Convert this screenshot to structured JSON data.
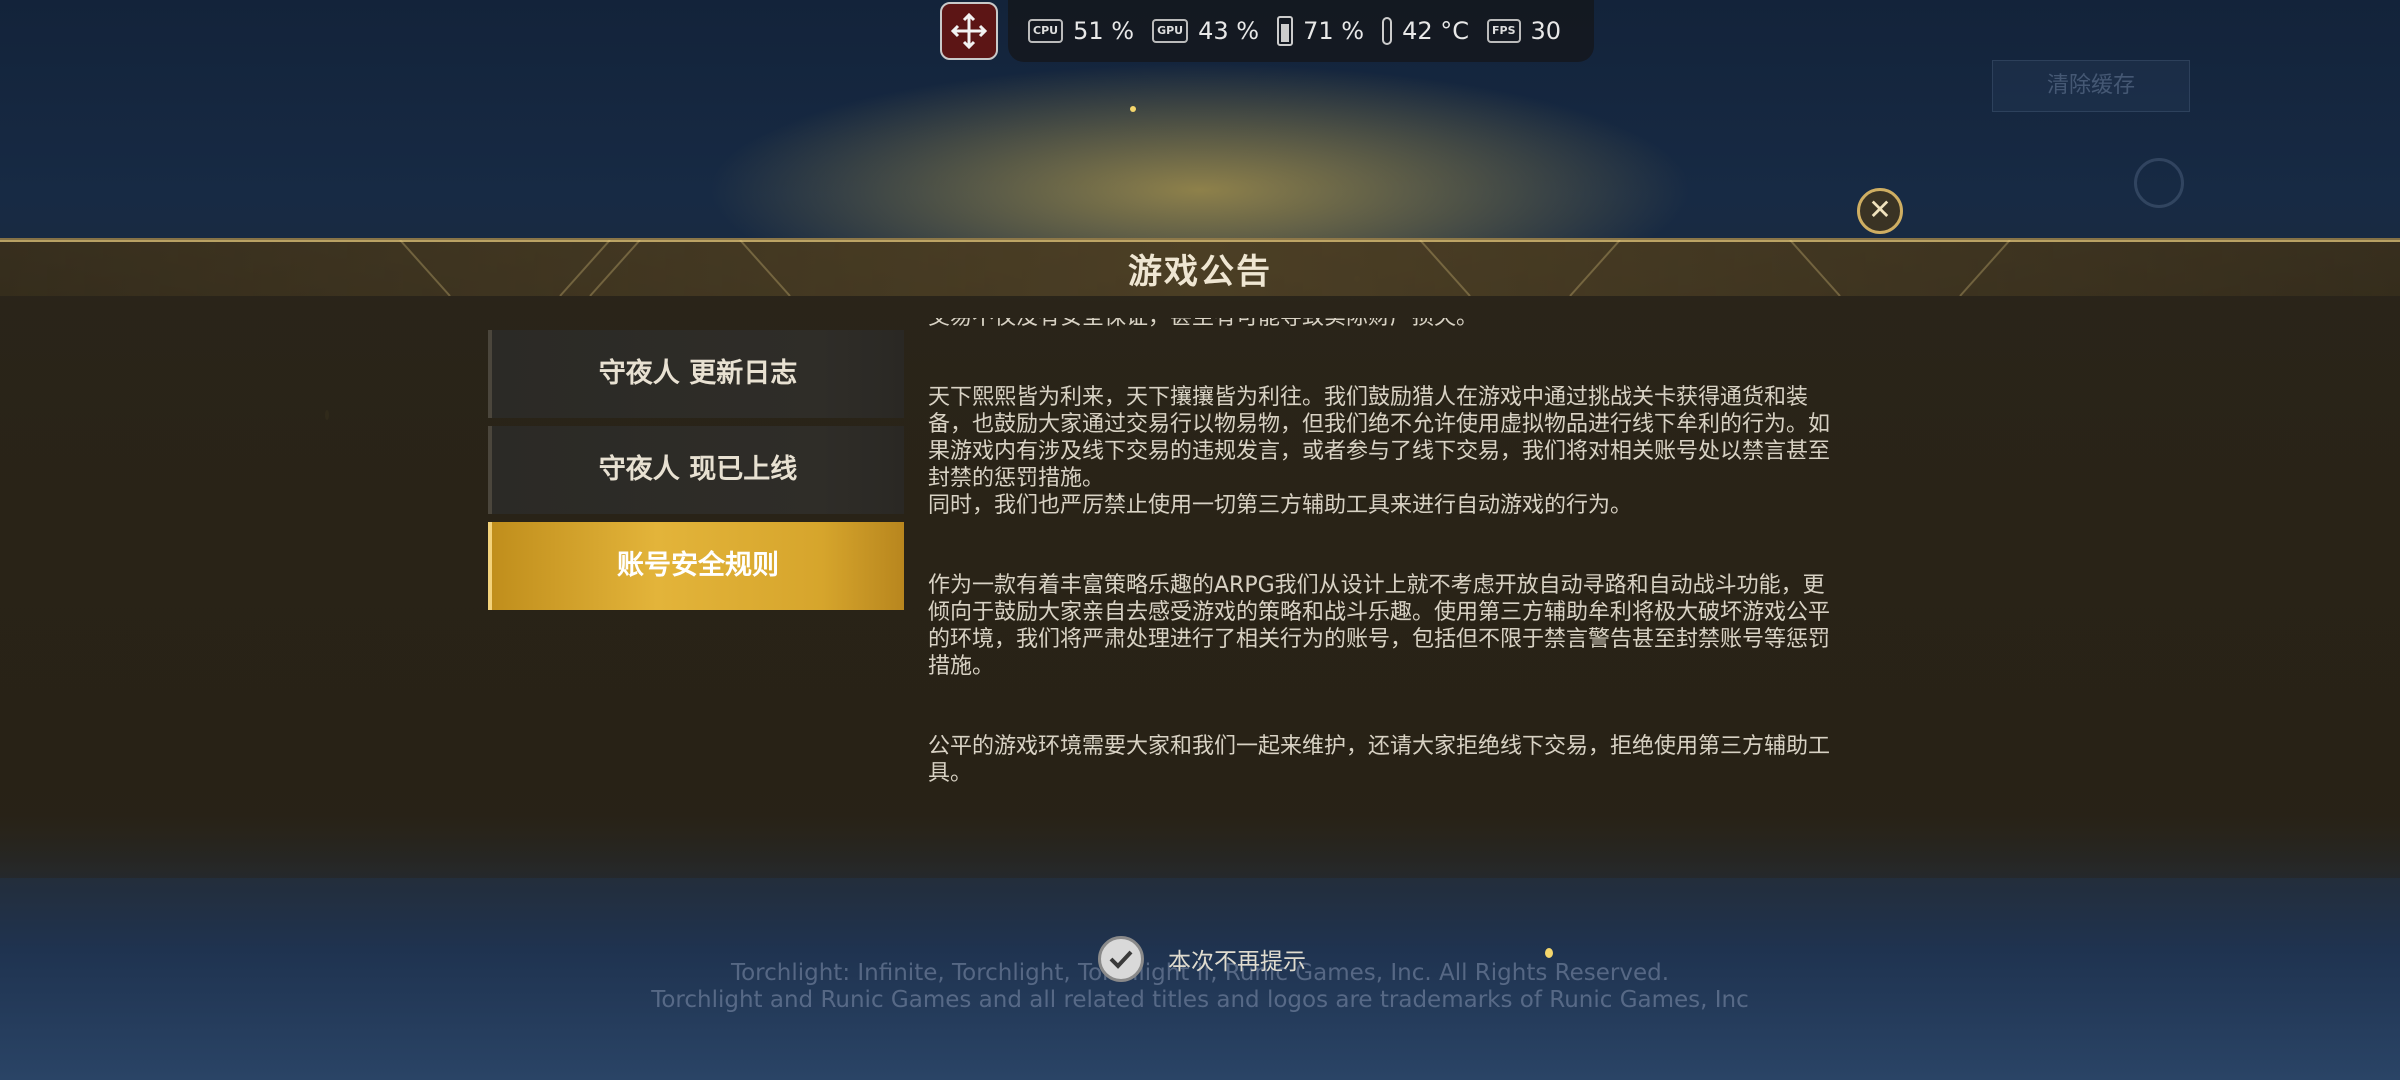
{
  "background": {
    "top_notice": "",
    "clear_cache_label": "清除缓存",
    "legal_lines": [
      "Torchlight: Infinite, Torchlight, Torchlight II, Runic Games, Inc. All Rights Reserved.",
      "Torchlight and Runic Games and all related titles and logos are trademarks of Runic Games, Inc"
    ]
  },
  "hud": {
    "cpu": "51 %",
    "gpu": "43 %",
    "battery": "71 %",
    "temperature": "42 °C",
    "fps": "30",
    "cpu_chip": "CPU",
    "gpu_chip": "GPU",
    "fps_chip": "FPS"
  },
  "dialog": {
    "title": "游戏公告",
    "close_symbol": "✕",
    "menu": [
      {
        "label": "守夜人 更新日志",
        "active": false
      },
      {
        "label": "守夜人 现已上线",
        "active": false
      },
      {
        "label": "账号安全规则",
        "active": true
      }
    ],
    "paragraphs": [
      "交易不仅没有安全保证，甚至有可能导致实际财产损失。",
      "天下熙熙皆为利来，天下攘攘皆为利往。我们鼓励猎人在游戏中通过挑战关卡获得通货和装备，也鼓励大家通过交易行以物易物，但我们绝不允许使用虚拟物品进行线下牟利的行为。如果游戏内有涉及线下交易的违规发言，或者参与了线下交易，我们将对相关账号处以禁言甚至封禁的惩罚措施。",
      "同时，我们也严厉禁止使用一切第三方辅助工具来进行自动游戏的行为。",
      "作为一款有着丰富策略乐趣的ARPG我们从设计上就不考虑开放自动寻路和自动战斗功能，更倾向于鼓励大家亲自去感受游戏的策略和战斗乐趣。使用第三方辅助牟利将极大破坏游戏公平的环境，我们将严肃处理进行了相关行为的账号，包括但不限于禁言警告甚至封禁账号等惩罚措施。",
      "公平的游戏环境需要大家和我们一起来维护，还请大家拒绝线下交易，拒绝使用第三方辅助工具。"
    ],
    "dont_remind_label": "本次不再提示",
    "dont_remind_checked": true
  }
}
